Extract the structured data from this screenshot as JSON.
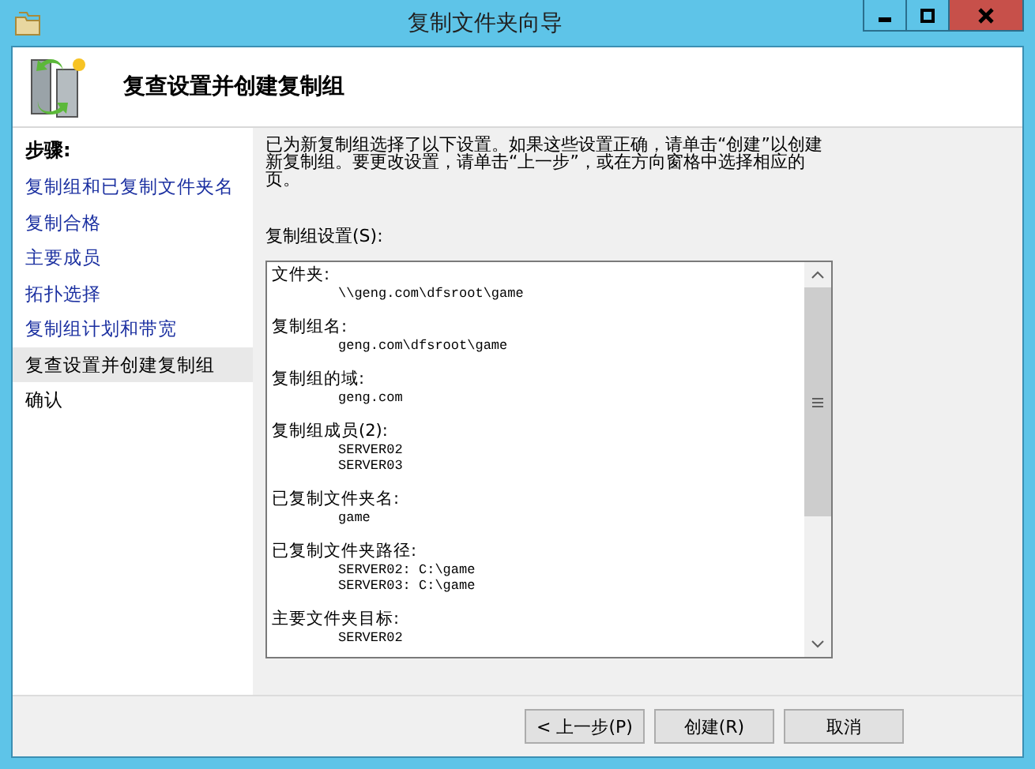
{
  "window": {
    "title": "复制文件夹向导"
  },
  "header": {
    "title": "复查设置并创建复制组"
  },
  "steps": {
    "heading": "步骤:",
    "items": [
      {
        "label": "复制组和已复制文件夹名",
        "selected": false,
        "completed": true
      },
      {
        "label": "复制合格",
        "selected": false,
        "completed": true
      },
      {
        "label": "主要成员",
        "selected": false,
        "completed": true
      },
      {
        "label": "拓扑选择",
        "selected": false,
        "completed": true
      },
      {
        "label": "复制组计划和带宽",
        "selected": false,
        "completed": true
      },
      {
        "label": "复查设置并创建复制组",
        "selected": true,
        "completed": false
      },
      {
        "label": "确认",
        "selected": false,
        "completed": false
      }
    ]
  },
  "description": "已为新复制组选择了以下设置。如果这些设置正确，请单击“创建”以创建新复制组。要更改设置，请单击“上一步”，或在方向窗格中选择相应的页。",
  "settings": {
    "label": "复制组设置(S):",
    "sections": [
      {
        "label": "文件夹:",
        "values": [
          "\\\\geng.com\\dfsroot\\game"
        ]
      },
      {
        "label": "复制组名:",
        "values": [
          "geng.com\\dfsroot\\game"
        ]
      },
      {
        "label": "复制组的域:",
        "values": [
          "geng.com"
        ]
      },
      {
        "label": "复制组成员(2):",
        "values": [
          "SERVER02",
          "SERVER03"
        ]
      },
      {
        "label": "已复制文件夹名:",
        "values": [
          "game"
        ]
      },
      {
        "label": "已复制文件夹路径:",
        "values": [
          "SERVER02: C:\\game",
          "SERVER03: C:\\game"
        ]
      },
      {
        "label": "主要文件夹目标:",
        "values": [
          "SERVER02"
        ]
      }
    ]
  },
  "buttons": [
    {
      "label": "< 上一步(P)",
      "disabled": false
    },
    {
      "label": "创建(R)",
      "disabled": false
    },
    {
      "label": "取消",
      "disabled": false
    }
  ]
}
